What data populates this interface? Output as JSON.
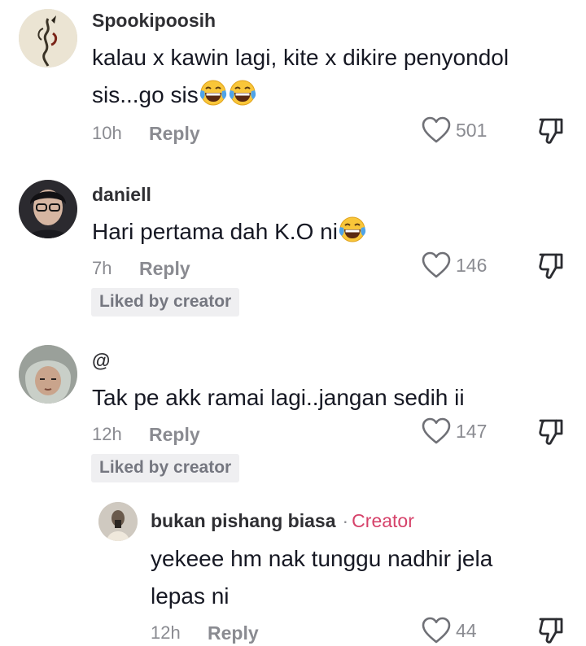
{
  "comments": [
    {
      "username": "Spookipoosih",
      "text_lines": [
        "kalau x kawin lagi, kite x dikire penyondol",
        "sis...go sis"
      ],
      "emojis": [
        "laughing-tears",
        "laughing-tears"
      ],
      "time": "10h",
      "reply_label": "Reply",
      "like_count": "501"
    },
    {
      "username": "daniell",
      "text_lines": [
        "Hari pertama dah K.O ni"
      ],
      "emojis": [
        "laughing-tears"
      ],
      "time": "7h",
      "reply_label": "Reply",
      "like_count": "146",
      "badge": "Liked by creator"
    },
    {
      "username": "@",
      "text_lines": [
        "Tak pe akk ramai lagi..jangan sedih ii"
      ],
      "time": "12h",
      "reply_label": "Reply",
      "like_count": "147",
      "badge": "Liked by creator"
    }
  ],
  "reply": {
    "username": "bukan pishang biasa",
    "separator": "·",
    "creator_label": "Creator",
    "text_lines": [
      "yekeee hm nak tunggu nadhir jela",
      "lepas ni"
    ],
    "time": "12h",
    "reply_label": "Reply",
    "like_count": "44"
  },
  "icons": {
    "like": "heart-outline-icon",
    "dislike": "thumbs-down-outline-icon",
    "emoji": "face-with-tears-of-joy"
  },
  "colors": {
    "text": "#161823",
    "secondary": "#8a8b91",
    "creator": "#d6426a",
    "badge_bg": "#efeff1"
  }
}
